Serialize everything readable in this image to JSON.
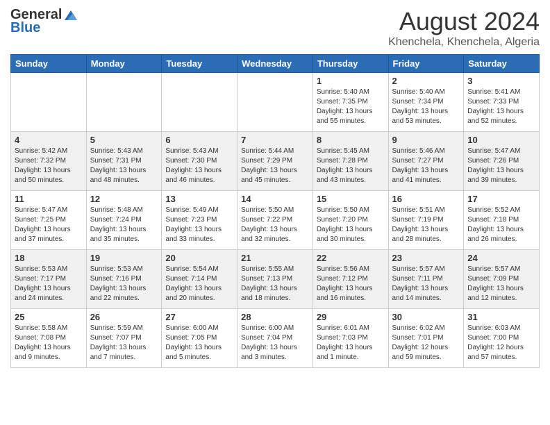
{
  "header": {
    "logo_general": "General",
    "logo_blue": "Blue",
    "month": "August 2024",
    "location": "Khenchela, Khenchela, Algeria"
  },
  "weekdays": [
    "Sunday",
    "Monday",
    "Tuesday",
    "Wednesday",
    "Thursday",
    "Friday",
    "Saturday"
  ],
  "weeks": [
    [
      {
        "day": "",
        "info": ""
      },
      {
        "day": "",
        "info": ""
      },
      {
        "day": "",
        "info": ""
      },
      {
        "day": "",
        "info": ""
      },
      {
        "day": "1",
        "info": "Sunrise: 5:40 AM\nSunset: 7:35 PM\nDaylight: 13 hours\nand 55 minutes."
      },
      {
        "day": "2",
        "info": "Sunrise: 5:40 AM\nSunset: 7:34 PM\nDaylight: 13 hours\nand 53 minutes."
      },
      {
        "day": "3",
        "info": "Sunrise: 5:41 AM\nSunset: 7:33 PM\nDaylight: 13 hours\nand 52 minutes."
      }
    ],
    [
      {
        "day": "4",
        "info": "Sunrise: 5:42 AM\nSunset: 7:32 PM\nDaylight: 13 hours\nand 50 minutes."
      },
      {
        "day": "5",
        "info": "Sunrise: 5:43 AM\nSunset: 7:31 PM\nDaylight: 13 hours\nand 48 minutes."
      },
      {
        "day": "6",
        "info": "Sunrise: 5:43 AM\nSunset: 7:30 PM\nDaylight: 13 hours\nand 46 minutes."
      },
      {
        "day": "7",
        "info": "Sunrise: 5:44 AM\nSunset: 7:29 PM\nDaylight: 13 hours\nand 45 minutes."
      },
      {
        "day": "8",
        "info": "Sunrise: 5:45 AM\nSunset: 7:28 PM\nDaylight: 13 hours\nand 43 minutes."
      },
      {
        "day": "9",
        "info": "Sunrise: 5:46 AM\nSunset: 7:27 PM\nDaylight: 13 hours\nand 41 minutes."
      },
      {
        "day": "10",
        "info": "Sunrise: 5:47 AM\nSunset: 7:26 PM\nDaylight: 13 hours\nand 39 minutes."
      }
    ],
    [
      {
        "day": "11",
        "info": "Sunrise: 5:47 AM\nSunset: 7:25 PM\nDaylight: 13 hours\nand 37 minutes."
      },
      {
        "day": "12",
        "info": "Sunrise: 5:48 AM\nSunset: 7:24 PM\nDaylight: 13 hours\nand 35 minutes."
      },
      {
        "day": "13",
        "info": "Sunrise: 5:49 AM\nSunset: 7:23 PM\nDaylight: 13 hours\nand 33 minutes."
      },
      {
        "day": "14",
        "info": "Sunrise: 5:50 AM\nSunset: 7:22 PM\nDaylight: 13 hours\nand 32 minutes."
      },
      {
        "day": "15",
        "info": "Sunrise: 5:50 AM\nSunset: 7:20 PM\nDaylight: 13 hours\nand 30 minutes."
      },
      {
        "day": "16",
        "info": "Sunrise: 5:51 AM\nSunset: 7:19 PM\nDaylight: 13 hours\nand 28 minutes."
      },
      {
        "day": "17",
        "info": "Sunrise: 5:52 AM\nSunset: 7:18 PM\nDaylight: 13 hours\nand 26 minutes."
      }
    ],
    [
      {
        "day": "18",
        "info": "Sunrise: 5:53 AM\nSunset: 7:17 PM\nDaylight: 13 hours\nand 24 minutes."
      },
      {
        "day": "19",
        "info": "Sunrise: 5:53 AM\nSunset: 7:16 PM\nDaylight: 13 hours\nand 22 minutes."
      },
      {
        "day": "20",
        "info": "Sunrise: 5:54 AM\nSunset: 7:14 PM\nDaylight: 13 hours\nand 20 minutes."
      },
      {
        "day": "21",
        "info": "Sunrise: 5:55 AM\nSunset: 7:13 PM\nDaylight: 13 hours\nand 18 minutes."
      },
      {
        "day": "22",
        "info": "Sunrise: 5:56 AM\nSunset: 7:12 PM\nDaylight: 13 hours\nand 16 minutes."
      },
      {
        "day": "23",
        "info": "Sunrise: 5:57 AM\nSunset: 7:11 PM\nDaylight: 13 hours\nand 14 minutes."
      },
      {
        "day": "24",
        "info": "Sunrise: 5:57 AM\nSunset: 7:09 PM\nDaylight: 13 hours\nand 12 minutes."
      }
    ],
    [
      {
        "day": "25",
        "info": "Sunrise: 5:58 AM\nSunset: 7:08 PM\nDaylight: 13 hours\nand 9 minutes."
      },
      {
        "day": "26",
        "info": "Sunrise: 5:59 AM\nSunset: 7:07 PM\nDaylight: 13 hours\nand 7 minutes."
      },
      {
        "day": "27",
        "info": "Sunrise: 6:00 AM\nSunset: 7:05 PM\nDaylight: 13 hours\nand 5 minutes."
      },
      {
        "day": "28",
        "info": "Sunrise: 6:00 AM\nSunset: 7:04 PM\nDaylight: 13 hours\nand 3 minutes."
      },
      {
        "day": "29",
        "info": "Sunrise: 6:01 AM\nSunset: 7:03 PM\nDaylight: 13 hours\nand 1 minute."
      },
      {
        "day": "30",
        "info": "Sunrise: 6:02 AM\nSunset: 7:01 PM\nDaylight: 12 hours\nand 59 minutes."
      },
      {
        "day": "31",
        "info": "Sunrise: 6:03 AM\nSunset: 7:00 PM\nDaylight: 12 hours\nand 57 minutes."
      }
    ]
  ]
}
